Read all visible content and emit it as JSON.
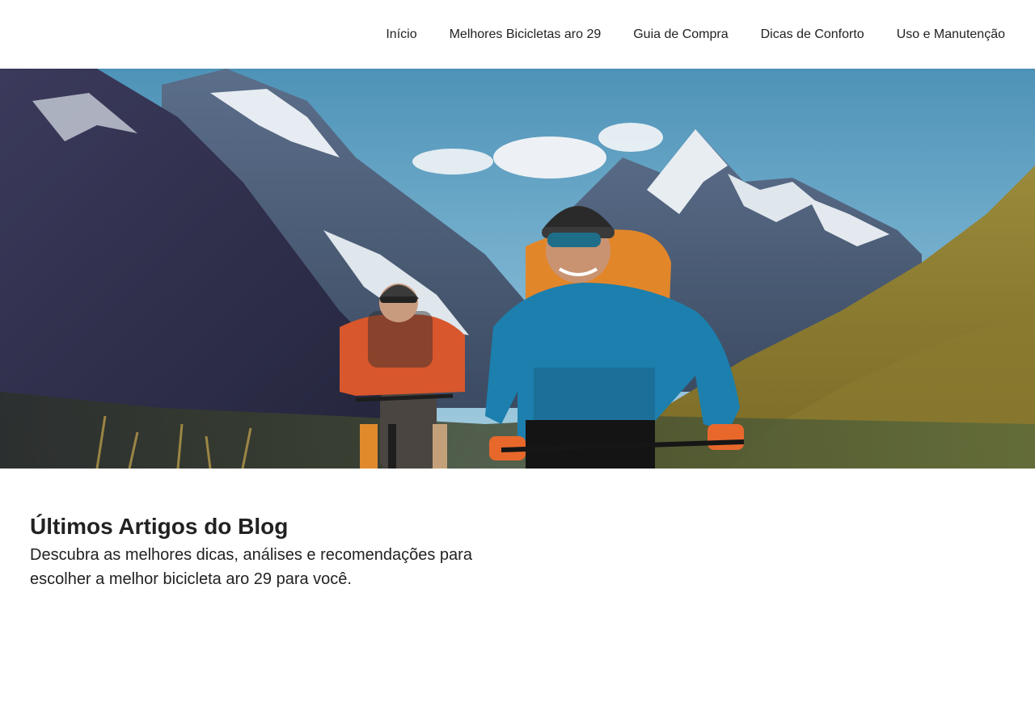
{
  "nav": {
    "items": [
      {
        "label": "Início"
      },
      {
        "label": "Melhores Bicicletas aro 29"
      },
      {
        "label": "Guia de Compra"
      },
      {
        "label": "Dicas de Conforto"
      },
      {
        "label": "Uso e Manutenção"
      }
    ]
  },
  "hero": {
    "image_subject": "two mountain bikers riding on an alpine trail with snowy peaks"
  },
  "blog": {
    "title": "Últimos Artigos do Blog",
    "subtitle": "Descubra as melhores dicas, análises e recomendações para escolher a melhor bicicleta aro 29 para você."
  }
}
